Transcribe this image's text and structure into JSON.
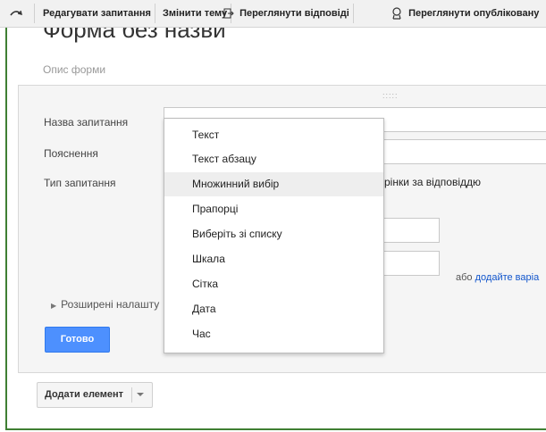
{
  "toolbar": {
    "first_icon": "curved-arrow-icon",
    "edit_question": "Редагувати запитання",
    "change_theme": "Змінити тему",
    "view_responses": "Переглянути відповіді",
    "view_published": "Переглянути опублікованy"
  },
  "form": {
    "title": "Форма без назви",
    "description_placeholder": "Опис форми"
  },
  "question": {
    "title_label": "Назва запитання",
    "help_label": "Пояснення",
    "type_label": "Тип запитання",
    "type_suffix": "рінки за відповіддю",
    "or_text": "або",
    "add_other_link": "додайте варіа",
    "advanced_label": "Розширені налашту",
    "done_button": "Готово"
  },
  "type_menu": {
    "items": [
      "Текст",
      "Текст абзацу",
      "Множинний вибір",
      "Прапорці",
      "Виберіть зі списку",
      "Шкала",
      "Сітка",
      "Дата",
      "Час"
    ],
    "selected": "Множинний вибір"
  },
  "add_element": {
    "label": "Додати елемент"
  },
  "colors": {
    "accent_blue": "#4d90fe",
    "frame_green": "#3f7f33",
    "link": "#1155cc"
  }
}
